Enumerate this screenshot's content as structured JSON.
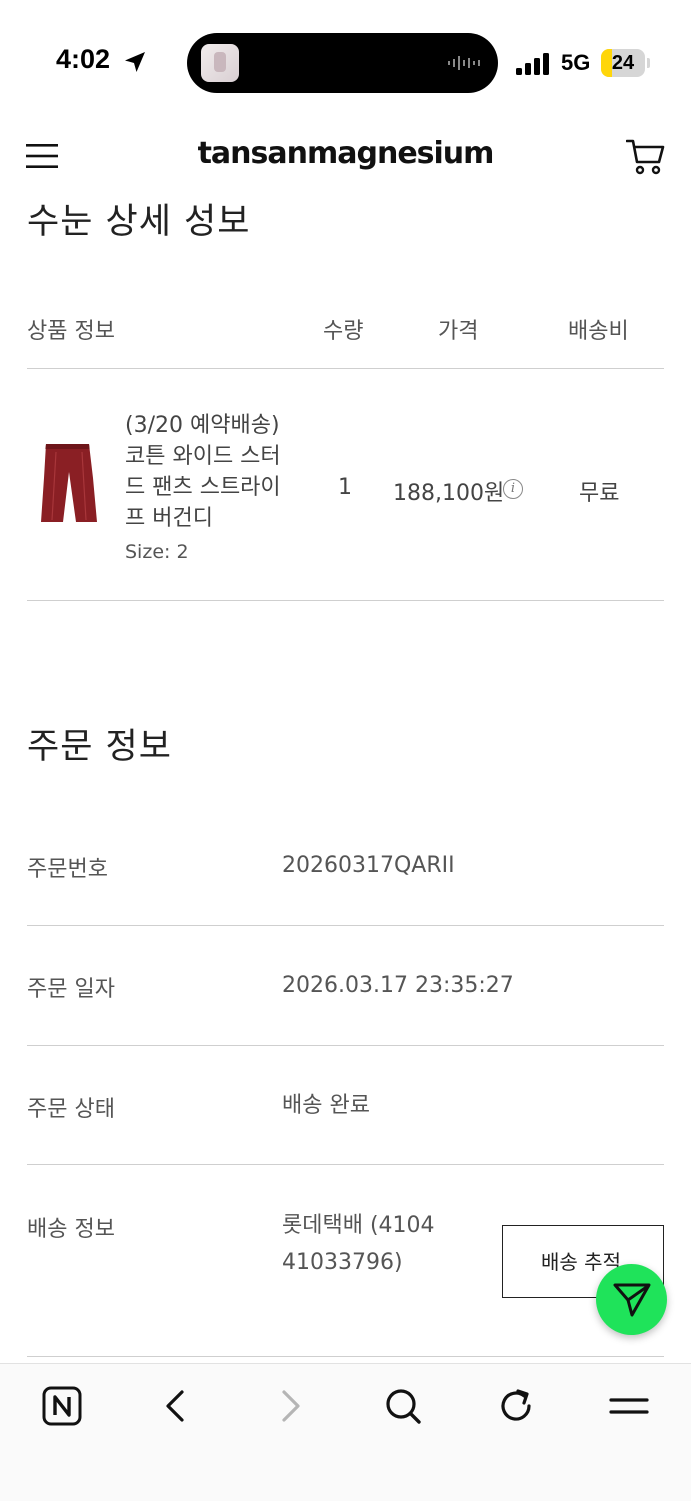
{
  "status_bar": {
    "time": "4:02",
    "network": "5G",
    "battery": "24",
    "battery_fraction": 0.24
  },
  "header": {
    "logo": "tansanmagnesium",
    "menu_icon": "hamburger-menu-icon",
    "cart_icon": "shopping-cart-icon"
  },
  "product_section": {
    "title": "수눈 상세 성보",
    "columns": [
      "상품 정보",
      "수량",
      "가격",
      "배송비"
    ],
    "item": {
      "name": "(3/20 예약배송) 코튼 와이드 스터드 팬츠 스트라이프 버건디",
      "size": "Size: 2",
      "quantity": "1",
      "price": "188,100원",
      "price_info_icon": "info-icon",
      "shipping": "무료",
      "image_color": "#8a1f24"
    }
  },
  "order_section": {
    "title": "주문 정보",
    "rows": [
      {
        "label": "주문번호",
        "value": "20260317QARII"
      },
      {
        "label": "주문 일자",
        "value": "2026.03.17 23:35:27"
      },
      {
        "label": "주문 상태",
        "value": "배송 완료"
      },
      {
        "label": "배송 정보",
        "value": "롯데택배 (410441033796)"
      }
    ],
    "tracking_button": "배송 추적"
  },
  "fab_icon": "send-icon",
  "browser_nav": {
    "icons": [
      "naver-home-icon",
      "back-icon",
      "forward-icon",
      "search-icon",
      "refresh-icon",
      "menu-icon"
    ]
  },
  "colors": {
    "fab": "#1fe35a",
    "battery": "#ffd60a"
  }
}
